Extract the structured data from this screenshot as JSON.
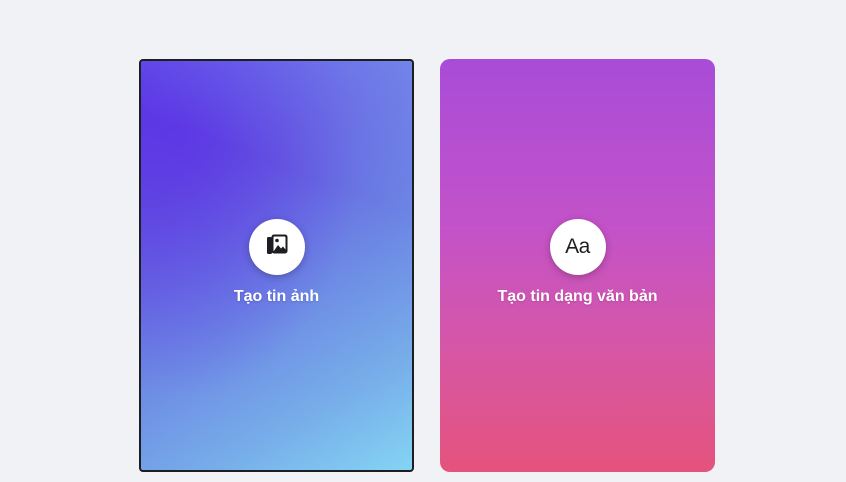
{
  "cards": [
    {
      "label": "Tạo tin ảnh",
      "icon": "photo-stack-icon"
    },
    {
      "label": "Tạo tin dạng văn bản",
      "icon": "text-aa-icon",
      "icon_text": "Aa"
    }
  ],
  "colors": {
    "background": "#f0f2f5",
    "photo_card_gradient": [
      "#5a36e6",
      "#6c86e4",
      "#84d4f4"
    ],
    "text_card_gradient": [
      "#a84cd8",
      "#c352c9",
      "#e5537c"
    ],
    "label": "#ffffff",
    "icon": "#1c1e21"
  }
}
